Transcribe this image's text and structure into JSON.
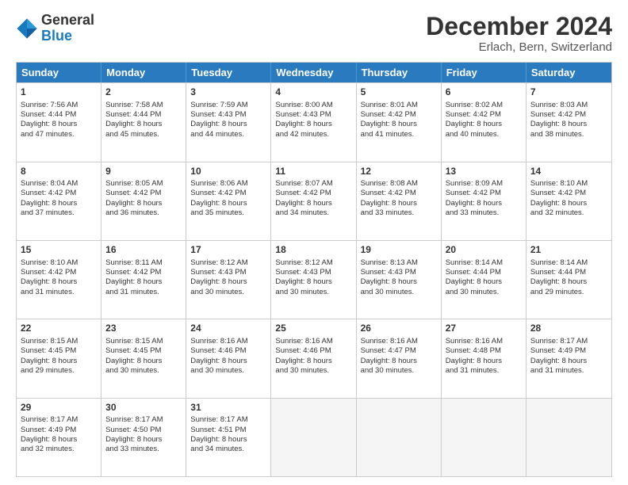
{
  "logo": {
    "general": "General",
    "blue": "Blue"
  },
  "title": "December 2024",
  "subtitle": "Erlach, Bern, Switzerland",
  "weekdays": [
    "Sunday",
    "Monday",
    "Tuesday",
    "Wednesday",
    "Thursday",
    "Friday",
    "Saturday"
  ],
  "weeks": [
    [
      {
        "day": "1",
        "lines": [
          "Sunrise: 7:56 AM",
          "Sunset: 4:44 PM",
          "Daylight: 8 hours",
          "and 47 minutes."
        ]
      },
      {
        "day": "2",
        "lines": [
          "Sunrise: 7:58 AM",
          "Sunset: 4:44 PM",
          "Daylight: 8 hours",
          "and 45 minutes."
        ]
      },
      {
        "day": "3",
        "lines": [
          "Sunrise: 7:59 AM",
          "Sunset: 4:43 PM",
          "Daylight: 8 hours",
          "and 44 minutes."
        ]
      },
      {
        "day": "4",
        "lines": [
          "Sunrise: 8:00 AM",
          "Sunset: 4:43 PM",
          "Daylight: 8 hours",
          "and 42 minutes."
        ]
      },
      {
        "day": "5",
        "lines": [
          "Sunrise: 8:01 AM",
          "Sunset: 4:42 PM",
          "Daylight: 8 hours",
          "and 41 minutes."
        ]
      },
      {
        "day": "6",
        "lines": [
          "Sunrise: 8:02 AM",
          "Sunset: 4:42 PM",
          "Daylight: 8 hours",
          "and 40 minutes."
        ]
      },
      {
        "day": "7",
        "lines": [
          "Sunrise: 8:03 AM",
          "Sunset: 4:42 PM",
          "Daylight: 8 hours",
          "and 38 minutes."
        ]
      }
    ],
    [
      {
        "day": "8",
        "lines": [
          "Sunrise: 8:04 AM",
          "Sunset: 4:42 PM",
          "Daylight: 8 hours",
          "and 37 minutes."
        ]
      },
      {
        "day": "9",
        "lines": [
          "Sunrise: 8:05 AM",
          "Sunset: 4:42 PM",
          "Daylight: 8 hours",
          "and 36 minutes."
        ]
      },
      {
        "day": "10",
        "lines": [
          "Sunrise: 8:06 AM",
          "Sunset: 4:42 PM",
          "Daylight: 8 hours",
          "and 35 minutes."
        ]
      },
      {
        "day": "11",
        "lines": [
          "Sunrise: 8:07 AM",
          "Sunset: 4:42 PM",
          "Daylight: 8 hours",
          "and 34 minutes."
        ]
      },
      {
        "day": "12",
        "lines": [
          "Sunrise: 8:08 AM",
          "Sunset: 4:42 PM",
          "Daylight: 8 hours",
          "and 33 minutes."
        ]
      },
      {
        "day": "13",
        "lines": [
          "Sunrise: 8:09 AM",
          "Sunset: 4:42 PM",
          "Daylight: 8 hours",
          "and 33 minutes."
        ]
      },
      {
        "day": "14",
        "lines": [
          "Sunrise: 8:10 AM",
          "Sunset: 4:42 PM",
          "Daylight: 8 hours",
          "and 32 minutes."
        ]
      }
    ],
    [
      {
        "day": "15",
        "lines": [
          "Sunrise: 8:10 AM",
          "Sunset: 4:42 PM",
          "Daylight: 8 hours",
          "and 31 minutes."
        ]
      },
      {
        "day": "16",
        "lines": [
          "Sunrise: 8:11 AM",
          "Sunset: 4:42 PM",
          "Daylight: 8 hours",
          "and 31 minutes."
        ]
      },
      {
        "day": "17",
        "lines": [
          "Sunrise: 8:12 AM",
          "Sunset: 4:43 PM",
          "Daylight: 8 hours",
          "and 30 minutes."
        ]
      },
      {
        "day": "18",
        "lines": [
          "Sunrise: 8:12 AM",
          "Sunset: 4:43 PM",
          "Daylight: 8 hours",
          "and 30 minutes."
        ]
      },
      {
        "day": "19",
        "lines": [
          "Sunrise: 8:13 AM",
          "Sunset: 4:43 PM",
          "Daylight: 8 hours",
          "and 30 minutes."
        ]
      },
      {
        "day": "20",
        "lines": [
          "Sunrise: 8:14 AM",
          "Sunset: 4:44 PM",
          "Daylight: 8 hours",
          "and 30 minutes."
        ]
      },
      {
        "day": "21",
        "lines": [
          "Sunrise: 8:14 AM",
          "Sunset: 4:44 PM",
          "Daylight: 8 hours",
          "and 29 minutes."
        ]
      }
    ],
    [
      {
        "day": "22",
        "lines": [
          "Sunrise: 8:15 AM",
          "Sunset: 4:45 PM",
          "Daylight: 8 hours",
          "and 29 minutes."
        ]
      },
      {
        "day": "23",
        "lines": [
          "Sunrise: 8:15 AM",
          "Sunset: 4:45 PM",
          "Daylight: 8 hours",
          "and 30 minutes."
        ]
      },
      {
        "day": "24",
        "lines": [
          "Sunrise: 8:16 AM",
          "Sunset: 4:46 PM",
          "Daylight: 8 hours",
          "and 30 minutes."
        ]
      },
      {
        "day": "25",
        "lines": [
          "Sunrise: 8:16 AM",
          "Sunset: 4:46 PM",
          "Daylight: 8 hours",
          "and 30 minutes."
        ]
      },
      {
        "day": "26",
        "lines": [
          "Sunrise: 8:16 AM",
          "Sunset: 4:47 PM",
          "Daylight: 8 hours",
          "and 30 minutes."
        ]
      },
      {
        "day": "27",
        "lines": [
          "Sunrise: 8:16 AM",
          "Sunset: 4:48 PM",
          "Daylight: 8 hours",
          "and 31 minutes."
        ]
      },
      {
        "day": "28",
        "lines": [
          "Sunrise: 8:17 AM",
          "Sunset: 4:49 PM",
          "Daylight: 8 hours",
          "and 31 minutes."
        ]
      }
    ],
    [
      {
        "day": "29",
        "lines": [
          "Sunrise: 8:17 AM",
          "Sunset: 4:49 PM",
          "Daylight: 8 hours",
          "and 32 minutes."
        ]
      },
      {
        "day": "30",
        "lines": [
          "Sunrise: 8:17 AM",
          "Sunset: 4:50 PM",
          "Daylight: 8 hours",
          "and 33 minutes."
        ]
      },
      {
        "day": "31",
        "lines": [
          "Sunrise: 8:17 AM",
          "Sunset: 4:51 PM",
          "Daylight: 8 hours",
          "and 34 minutes."
        ]
      },
      {
        "day": "",
        "lines": []
      },
      {
        "day": "",
        "lines": []
      },
      {
        "day": "",
        "lines": []
      },
      {
        "day": "",
        "lines": []
      }
    ]
  ]
}
